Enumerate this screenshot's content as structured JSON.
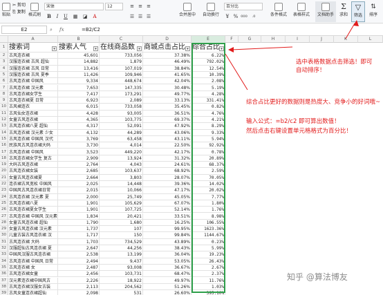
{
  "ribbon": {
    "paste": "粘贴",
    "cut": "剪切",
    "copy": "复制",
    "format_painter": "格式刷",
    "font": "宋体",
    "font_size": "12",
    "merge_center": "合并居中",
    "auto_wrap": "自动换行",
    "number_format": "百分比",
    "conditional_format": "条件格式",
    "table_style": "表格样式",
    "doc_assistant": "文档助手",
    "sum": "求和",
    "filter": "筛选",
    "sort": "排序"
  },
  "formula_bar": {
    "cell_ref": "E2",
    "fx": "fx",
    "formula": "=B2/C2"
  },
  "columns": [
    "A",
    "B",
    "C",
    "D",
    "E",
    "F",
    "G",
    "H",
    "I",
    "J",
    "K",
    "L"
  ],
  "headers": [
    "搜索词",
    "搜索人气",
    "在线商品数",
    "商城点击占比",
    "综合占比"
  ],
  "rows": [
    [
      "2",
      "古风连衣裙",
      "45,601",
      "733,056",
      "37.38%",
      "6.22%"
    ],
    [
      "3",
      "汉服连衣裙 古风 超仙",
      "14,882",
      "1,879",
      "46.49%",
      "792.02%"
    ],
    [
      "4",
      "汉服连衣裙 古风 日常",
      "13,416",
      "107,019",
      "38.84%",
      "12.54%"
    ],
    [
      "5",
      "汉服连衣裙 古风 夏季",
      "11,426",
      "109,946",
      "41.65%",
      "10.39%"
    ],
    [
      "6",
      "古风连衣裙 中国风",
      "9,334",
      "448,674",
      "42.04%",
      "2.08%"
    ],
    [
      "7",
      "古风连衣裙 汉元素",
      "7,653",
      "147,335",
      "30.48%",
      "5.19%"
    ],
    [
      "8",
      "古风连衣裙女学生",
      "7,417",
      "173,291",
      "49.77%",
      "4.28%"
    ],
    [
      "9",
      "古风连衣裙夏 日常",
      "6,923",
      "2,089",
      "33.13%",
      "331.41%"
    ],
    [
      "10",
      "古风裙连衣",
      "6,015",
      "733,058",
      "35.45%",
      "0.82%"
    ],
    [
      "11",
      "古风仙女连衣裙",
      "4,428",
      "93,005",
      "36.51%",
      "4.76%"
    ],
    [
      "12",
      "女童古风连衣裙",
      "4,365",
      "103,775",
      "69.37%",
      "4.21%"
    ],
    [
      "13",
      "古风连衣裙八夏 超仙",
      "4,317",
      "52,091",
      "47.92%",
      "8.29%"
    ],
    [
      "14",
      "古风连衣裙 汉元素 少女",
      "4,132",
      "44,289",
      "43.06%",
      "9.33%"
    ],
    [
      "15",
      "古风连衣裙 中国风 汉代",
      "3,769",
      "63,458",
      "43.11%",
      "5.94%"
    ],
    [
      "16",
      "民族风古风连衣裙大码",
      "3,730",
      "4,014",
      "22.50%",
      "92.92%"
    ],
    [
      "17",
      "古风连衣裙 中国风",
      "3,523",
      "449,220",
      "42.17%",
      "0.78%"
    ],
    [
      "18",
      "古风连衣裙女学生 复古",
      "2,909",
      "13,924",
      "31.32%",
      "20.89%"
    ],
    [
      "19",
      "大码古风连衣裙",
      "2,764",
      "4,043",
      "24.61%",
      "68.37%"
    ],
    [
      "20",
      "古风连衣裙女装",
      "2,685",
      "103,637",
      "68.92%",
      "2.59%"
    ],
    [
      "21",
      "女童古风连衣裙夏",
      "2,664",
      "3,803",
      "28.07%",
      "70.05%"
    ],
    [
      "22",
      "连衣裙古风宽松 中国风",
      "2,025",
      "14,448",
      "39.36%",
      "14.02%"
    ],
    [
      "23",
      "中国风古风连衣裙日常",
      "2,015",
      "10,066",
      "47.17%",
      "20.02%"
    ],
    [
      "24",
      "古风连衣裙 汉元素 夏",
      "2,000",
      "25,749",
      "45.05%",
      "7.77%"
    ],
    [
      "25",
      "古风连衣裙八夏",
      "1,901",
      "105,629",
      "67.07%",
      "1.80%"
    ],
    [
      "26",
      "古风连衣裙夏女学生",
      "1,901",
      "107,725",
      "52.14%",
      "1.76%"
    ],
    [
      "27",
      "古风连衣裙 中国风 汉元素",
      "1,834",
      "20,421",
      "33.51%",
      "8.98%"
    ],
    [
      "28",
      "女童古风连衣裙 超仙",
      "1,790",
      "1,680",
      "16.25%",
      "106.55%"
    ],
    [
      "29",
      "女童古风连衣裙 汉元素",
      "1,737",
      "107",
      "99.95%",
      "1623.36%"
    ],
    [
      "30",
      "儿童古装古风连衣裙 汉",
      "1,717",
      "150",
      "99.84%",
      "1144.67%"
    ],
    [
      "31",
      "古风连衣裙 大码",
      "1,703",
      "734,529",
      "43.89%",
      "0.23%"
    ],
    [
      "32",
      "汉服超仙古风连衣裙 夏",
      "2,647",
      "44,256",
      "38.43%",
      "5.99%"
    ],
    [
      "33",
      "中国风汉服古风连衣裙",
      "2,538",
      "13,199",
      "36.04%",
      "19.23%"
    ],
    [
      "34",
      "古风连衣裙 中国风 日常",
      "2,494",
      "9,437",
      "53.05%",
      "26.43%"
    ],
    [
      "35",
      "古风连衣裙 女",
      "2,487",
      "93,008",
      "36.67%",
      "2.67%"
    ],
    [
      "36",
      "古风连衣裙女童",
      "2,456",
      "103,731",
      "68.47%",
      "2.37%"
    ],
    [
      "37",
      "汉元素连衣裙中国风古",
      "2,226",
      "18,922",
      "49.97%",
      "11.76%"
    ],
    [
      "38",
      "古风连衣裙汉服女古装",
      "2,113",
      "204,562",
      "51.26%",
      "1.03%"
    ],
    [
      "39",
      "古风女童连衣裙超仙",
      "2,098",
      "531",
      "26.60%",
      "395.10%"
    ]
  ],
  "annotations": {
    "filter_note": "选中表格数据点击筛选！即可自动排序！",
    "ratio_note": "综合占比更好的数据则是热度大、竞争小的好词哦~",
    "formula_note": "输入公式：=b2/c2 即可算出数值！",
    "format_note": "然后点击右键设置单元格格式为百分比！"
  },
  "watermark": "知乎 @算法博友",
  "colors": {
    "annotation": "#e21b1b",
    "selection": "#2e9f4a"
  }
}
